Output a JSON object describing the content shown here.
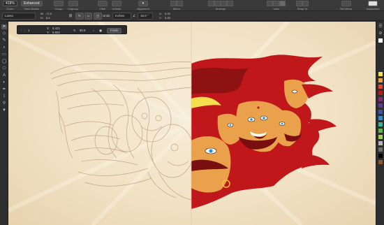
{
  "toolbar": {
    "zoom_value": "419%",
    "zoom_label": "Zoom",
    "view_mode_value": "Enhanced",
    "view_mode_label": "View Modes",
    "group_label": "Group",
    "ungroup_label": "Ungroup",
    "hide_label": "Hide",
    "unhide_label": "Unhide",
    "align_label": "Alignment",
    "mirror_label": "Mirror",
    "arrange_label": "Arrange",
    "view_label": "View",
    "snap_label": "Snap To",
    "set_menu_label": "Set Menu",
    "inspectors_label": "Inspectors"
  },
  "context_bar": {
    "tool_name": "Lasso",
    "w_label": "W:",
    "w_value": "17.8",
    "h_label": "H:",
    "h_value": "8.6",
    "units_label": "Units",
    "units_value": "Inches",
    "angle_value": "16.0 °",
    "sx_label": "X:",
    "sx_value": "5.25",
    "sy_label": "Y:",
    "sy_value": "5.25"
  },
  "transform_panel": {
    "count_value": "1",
    "x_label": "X:",
    "x_value": "5.422",
    "y_label": "Y:",
    "y_value": "5.603",
    "angle_value": "80.9",
    "finish_label": "Finish"
  },
  "tools": [
    "pick-tool",
    "node-tool",
    "curve-tool",
    "zoom-tool",
    "rectangle-tool",
    "ellipse-tool",
    "polygon-tool",
    "text-tool",
    "fill-tool",
    "pen-tool",
    "lasso-tool",
    "eyedropper-tool",
    "paint-tool"
  ],
  "colors": {
    "accent_red": "#c0171b",
    "dark_red": "#7a0f0f",
    "skin": "#e9a24b",
    "line_art": "#c9aa8f",
    "canvas": "#f3e6cc",
    "chrome": "#2b2b2b"
  },
  "palette": [
    "#ffffff",
    "#f4e04d",
    "#f0a33b",
    "#e8463b",
    "#c0171b",
    "#8e2a75",
    "#5b3c93",
    "#3b56a6",
    "#2f8fd0",
    "#39b39a",
    "#5cb94a",
    "#9ccf55",
    "#b5b5b5",
    "#6e6e6e",
    "#000000",
    "#8b5a2b"
  ]
}
